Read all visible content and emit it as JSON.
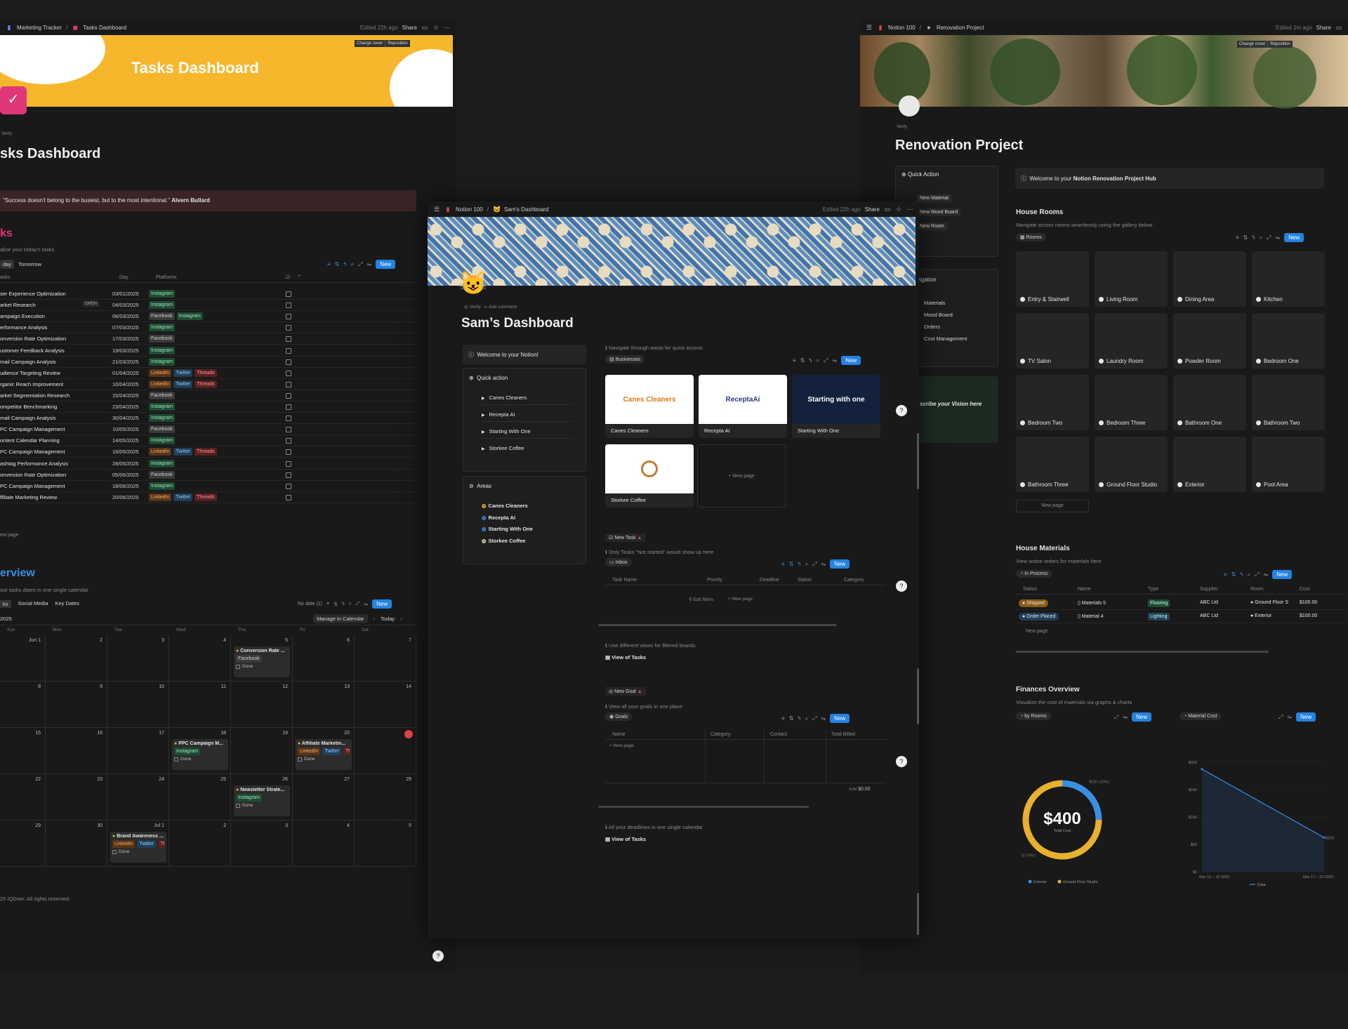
{
  "left": {
    "breadcrumb": [
      "Marketing Tracker",
      "Tasks Dashboard"
    ],
    "edited": "Edited 22h ago",
    "share": "Share",
    "cover_buttons": [
      "Change cover",
      "Reposition"
    ],
    "cover_title": "Tasks Dashboard",
    "verify": "Verify",
    "page_title": "sks Dashboard",
    "quote": "\"Success doesn't belong to the busiest, but to the most intentional.\"",
    "quote_author": "Alvern Bullard",
    "tasks_heading": "ks",
    "tasks_sub": "alize your today's tasks",
    "views": [
      "day",
      "Tomorrow"
    ],
    "new": "New",
    "columns": [
      "asks",
      "Day",
      "Platforms"
    ],
    "open_label": "OPEN",
    "tasks": [
      {
        "name": "ser Experience Optimization",
        "day": "03/01/2025",
        "tags": [
          "Instagram"
        ]
      },
      {
        "name": "arket Research",
        "day": "04/03/2025",
        "tags": [
          "Instagram"
        ]
      },
      {
        "name": "ampaign Execution",
        "day": "06/03/2025",
        "tags": [
          "Facebook",
          "Instagram"
        ]
      },
      {
        "name": "erformance Analysis",
        "day": "07/03/2025",
        "tags": [
          "Instagram"
        ]
      },
      {
        "name": "onversion Rate Optimization",
        "day": "17/03/2025",
        "tags": [
          "Facebook"
        ]
      },
      {
        "name": "ustomer Feedback Analysis",
        "day": "19/03/2025",
        "tags": [
          "Instagram"
        ]
      },
      {
        "name": "mail Campaign Analysis",
        "day": "21/03/2025",
        "tags": [
          "Instagram"
        ]
      },
      {
        "name": "udience Targeting Review",
        "day": "01/04/2025",
        "tags": [
          "LinkedIn",
          "Twitter",
          "Threads"
        ]
      },
      {
        "name": "rganic Reach Improvement",
        "day": "10/04/2025",
        "tags": [
          "LinkedIn",
          "Twitter",
          "Threads"
        ]
      },
      {
        "name": "arket Segmentation Research",
        "day": "15/04/2025",
        "tags": [
          "Facebook"
        ]
      },
      {
        "name": "ompetitor Benchmarking",
        "day": "23/04/2025",
        "tags": [
          "Instagram"
        ]
      },
      {
        "name": "mail Campaign Analysis",
        "day": "30/04/2025",
        "tags": [
          "Instagram"
        ]
      },
      {
        "name": "PC Campaign Management",
        "day": "10/05/2025",
        "tags": [
          "Facebook"
        ]
      },
      {
        "name": "ontent Calendar Planning",
        "day": "14/05/2025",
        "tags": [
          "Instagram"
        ]
      },
      {
        "name": "PC Campaign Management",
        "day": "16/05/2025",
        "tags": [
          "LinkedIn",
          "Twitter",
          "Threads"
        ]
      },
      {
        "name": "ashtag Performance Analysis",
        "day": "28/05/2025",
        "tags": [
          "Instagram"
        ]
      },
      {
        "name": "onversion Rate Optimization",
        "day": "05/06/2025",
        "tags": [
          "Facebook"
        ]
      },
      {
        "name": "PC Campaign Management",
        "day": "18/06/2025",
        "tags": [
          "Instagram"
        ]
      },
      {
        "name": "ffiliate Marketing Review",
        "day": "20/06/2025",
        "tags": [
          "LinkedIn",
          "Twitter",
          "Threads"
        ]
      }
    ],
    "new_page": "ew page",
    "overview_heading": "erview",
    "overview_sub": "our tasks dates in one single calendar",
    "cal_tabs": [
      "ks",
      "Social Media",
      "Key Dates"
    ],
    "no_date": "No date (1)",
    "month": "2025",
    "manage": "Manage in Calendar",
    "today": "Today",
    "weekdays": [
      "Sun",
      "Mon",
      "Tue",
      "Wed",
      "Thu",
      "Fri",
      "Sat"
    ],
    "weeks": [
      [
        "Jun 1",
        "2",
        "3",
        "4",
        "5",
        "6",
        "7"
      ],
      [
        "8",
        "9",
        "10",
        "11",
        "12",
        "13",
        "14"
      ],
      [
        "15",
        "16",
        "17",
        "18",
        "19",
        "20",
        "21"
      ],
      [
        "22",
        "23",
        "24",
        "25",
        "26",
        "27",
        "28"
      ],
      [
        "29",
        "30",
        "Jul 1",
        "2",
        "3",
        "4",
        "5"
      ]
    ],
    "events": [
      {
        "title": "Conversion Rate ...",
        "tags": [
          "Facebook"
        ],
        "done": "Done",
        "week": 0,
        "day": 4
      },
      {
        "title": "PPC Campaign M...",
        "tags": [
          "Instagram"
        ],
        "done": "Done",
        "week": 2,
        "day": 3
      },
      {
        "title": "Affiliate Marketin...",
        "tags": [
          "LinkedIn",
          "Twitter",
          "Threa"
        ],
        "done": "Done",
        "week": 2,
        "day": 5
      },
      {
        "title": "Newsletter Strate...",
        "tags": [
          "Instagram"
        ],
        "done": "Done",
        "week": 3,
        "day": 4
      },
      {
        "title": "Brand Awareness ...",
        "tags": [
          "LinkedIn",
          "Twitter",
          "Thre"
        ],
        "done": "Done",
        "week": 4,
        "day": 2
      }
    ],
    "footer": "25 IQDoer. All rights reserved."
  },
  "center": {
    "breadcrumb": [
      "Notion 100",
      "Sam's Dashboard"
    ],
    "edited": "Edited 22h ago",
    "share": "Share",
    "verify": "Verify",
    "add_comment": "Add comment",
    "title": "Sam’s Dashboard",
    "welcome": "Welcome to your Notion!",
    "quick_action": "Quick action",
    "quick_items": [
      "Canes Cleaners",
      "Recepta AI",
      "Starting With One",
      "Storkee Coffee"
    ],
    "areas": "Areas",
    "area_items": [
      "Canes Cleaners",
      "Recepta AI",
      "Starting With One",
      "Storkee Coffee"
    ],
    "nav_hint": "Navigate through areas for quick access",
    "businesses": "Businesses",
    "new": "New",
    "gallery": [
      {
        "name": "Canes Cleaners",
        "logo": "Canes Cleaners",
        "bg": "#ffffff"
      },
      {
        "name": "Recepta AI",
        "logo": "ReceptaAi",
        "bg": "#ffffff"
      },
      {
        "name": "Starting With One",
        "logo": "Starting with one",
        "bg": "#14213d"
      },
      {
        "name": "Storkee Coffee",
        "logo": "",
        "bg": "#ffffff"
      }
    ],
    "new_page": "New page",
    "new_task": "New Task",
    "task_hint": "Only Tasks \"Not started\" would show up here",
    "inbox": "Inbox",
    "task_cols": [
      "Task Name",
      "Priority",
      "Deadline",
      "Status",
      "Category"
    ],
    "edit_filters": "Edit filters",
    "views_hint": "Use different views for filtered boards",
    "view_tasks": "View of Tasks",
    "new_goal": "New Goal",
    "goal_hint": "View all your goals in one place",
    "goals": "Goals",
    "goal_cols": [
      "Name",
      "Category",
      "Contact",
      "Total Billed"
    ],
    "sum_label": "SUM",
    "sum_value": "$0.00",
    "deadline_hint": "All your deadlines in one single calendar",
    "view_tasks2": "View of Tasks"
  },
  "right": {
    "breadcrumb": [
      "Notion 100",
      "Renovation Project"
    ],
    "edited": "Edited 1m ago",
    "share": "Share",
    "cover_buttons": [
      "Change cover",
      "Reposition"
    ],
    "verify": "Verify",
    "title": "Renovation Project",
    "quick_action": "Quick Action",
    "quick_items": [
      "New Material",
      "New Mood Board",
      "New Room"
    ],
    "welcome": "Welcome to your",
    "welcome_bold": "Notion Renovation Project Hub",
    "navigation": "vigation",
    "nav_items": [
      "Materials",
      "Mood Board",
      "Orders",
      "Cost Management"
    ],
    "vision": "scribe your Vision here",
    "house_rooms": "House Rooms",
    "rooms_sub": "Navigate across rooms seamlessly using the gallery below",
    "rooms_view": "Rooms",
    "new": "New",
    "rooms": [
      "Entry & Stairwell",
      "Living Room",
      "Dining Area",
      "Kitchen",
      "TV Salon",
      "Laundry Room",
      "Powder Room",
      "Bedroom One",
      "Bedroom Two",
      "Bedroom Three",
      "Bathroom One",
      "Bathroom Two",
      "Bathroom Three",
      "Ground Floor Studio",
      "Exterior",
      "Pool Area"
    ],
    "new_page": "New page",
    "materials_heading": "House Materials",
    "materials_sub": "View active orders for materials here",
    "in_process": "In Process",
    "mat_cols": [
      "Status",
      "Name",
      "Type",
      "Supplier",
      "Room",
      "Cost"
    ],
    "materials": [
      {
        "status": "Shipped",
        "status_color": "#8a5a14",
        "name": "Materials 5",
        "type": "Flooring",
        "type_color": "#1e4b33",
        "supplier": "ABC Ltd",
        "room": "Ground Floor S",
        "cost": "$100.00"
      },
      {
        "status": "Order Placed",
        "status_color": "#1f3f5a",
        "name": "Material 4",
        "type": "Lighting",
        "type_color": "#1f3f5a",
        "supplier": "ABC Ltd",
        "room": "Exterior",
        "cost": "$100.00"
      }
    ],
    "finances_heading": "Finances Overview",
    "finances_sub": "Visualize the cost of materials via graphs & charts",
    "by_rooms": "by Rooms",
    "material_cost": "Material Cost"
  },
  "chart_data": [
    {
      "type": "pie",
      "title": "",
      "center_value": "$400",
      "center_label": "Total Cost",
      "categories": [
        "Exterior",
        "Ground Floor Studio"
      ],
      "values": [
        100,
        300
      ],
      "slice_labels": [
        "$100 (25%)",
        "$300 (75%)"
      ],
      "colors": [
        "#3b8fe0",
        "#e8b02e"
      ],
      "legend_placement": "bottom"
    },
    {
      "type": "area",
      "title": "",
      "x": [
        "Mar 10 – 16 2023",
        "Mar 17 – 23 2023"
      ],
      "series": [
        {
          "name": "Data",
          "values": [
            300,
            100
          ]
        }
      ],
      "ylim": [
        0,
        320
      ],
      "yticks": [
        "$0",
        "$80",
        "$160",
        "$240",
        "$320"
      ],
      "end_label": "$100",
      "colors": [
        "#3b8fe0"
      ],
      "legend_placement": "bottom"
    }
  ]
}
